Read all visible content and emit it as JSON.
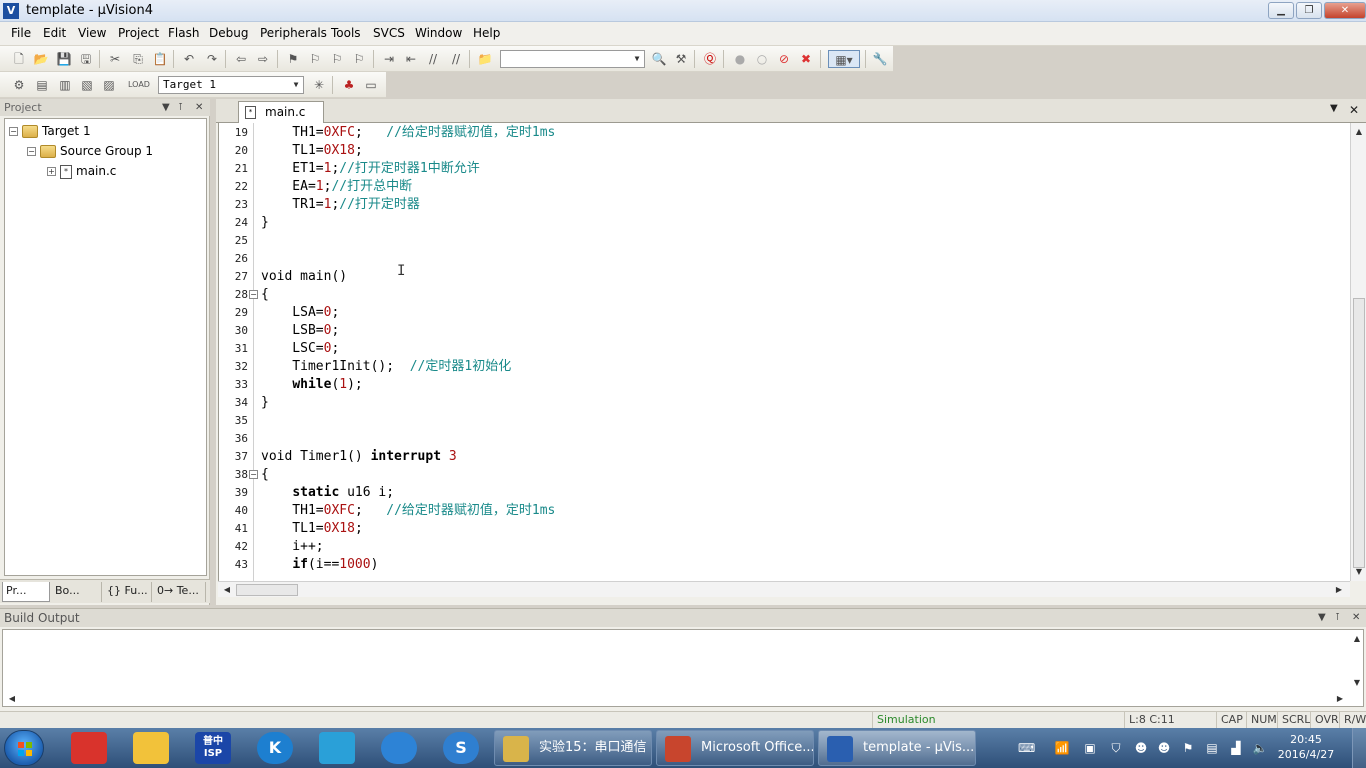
{
  "window": {
    "title": "template  - µVision4",
    "app_icon": "V"
  },
  "menu": [
    "File",
    "Edit",
    "View",
    "Project",
    "Flash",
    "Debug",
    "Peripherals",
    "Tools",
    "SVCS",
    "Window",
    "Help"
  ],
  "toolbar": {
    "target_combo": "Target 1"
  },
  "project_panel": {
    "title": "Project",
    "tree": {
      "target": "Target 1",
      "group": "Source Group 1",
      "file": "main.c"
    },
    "tabs": [
      "Pr...",
      "Bo...",
      "{} Fu...",
      "0→ Te..."
    ]
  },
  "editor": {
    "tab": "main.c",
    "lines": [
      {
        "n": "19",
        "segs": [
          [
            "    TH1=",
            ""
          ],
          [
            "0XFC",
            "num"
          ],
          [
            ";   ",
            ""
          ],
          [
            "//给定时器赋初值，定时1ms",
            "cm"
          ]
        ]
      },
      {
        "n": "20",
        "segs": [
          [
            "    TL1=",
            ""
          ],
          [
            "0X18",
            "num"
          ],
          [
            ";",
            ""
          ]
        ]
      },
      {
        "n": "21",
        "segs": [
          [
            "    ET1=",
            ""
          ],
          [
            "1",
            "num"
          ],
          [
            ";",
            ""
          ],
          [
            "//打开定时器1中断允许",
            "cm"
          ]
        ]
      },
      {
        "n": "22",
        "segs": [
          [
            "    EA=",
            ""
          ],
          [
            "1",
            "num"
          ],
          [
            ";",
            ""
          ],
          [
            "//打开总中断",
            "cm"
          ]
        ]
      },
      {
        "n": "23",
        "segs": [
          [
            "    TR1=",
            ""
          ],
          [
            "1",
            "num"
          ],
          [
            ";",
            ""
          ],
          [
            "//打开定时器",
            "cm"
          ]
        ]
      },
      {
        "n": "24",
        "segs": [
          [
            "}",
            ""
          ]
        ]
      },
      {
        "n": "25",
        "segs": []
      },
      {
        "n": "26",
        "segs": []
      },
      {
        "n": "27",
        "segs": [
          [
            "void main()",
            ""
          ]
        ]
      },
      {
        "n": "28",
        "segs": [
          [
            "{",
            ""
          ]
        ]
      },
      {
        "n": "29",
        "segs": [
          [
            "    LSA=",
            ""
          ],
          [
            "0",
            "num"
          ],
          [
            ";",
            ""
          ]
        ]
      },
      {
        "n": "30",
        "segs": [
          [
            "    LSB=",
            ""
          ],
          [
            "0",
            "num"
          ],
          [
            ";",
            ""
          ]
        ]
      },
      {
        "n": "31",
        "segs": [
          [
            "    LSC=",
            ""
          ],
          [
            "0",
            "num"
          ],
          [
            ";",
            ""
          ]
        ]
      },
      {
        "n": "32",
        "segs": [
          [
            "    Timer1Init();  ",
            ""
          ],
          [
            "//定时器1初始化",
            "cm"
          ]
        ]
      },
      {
        "n": "33",
        "segs": [
          [
            "    ",
            ""
          ],
          [
            "while",
            "kw"
          ],
          [
            "(",
            ""
          ],
          [
            "1",
            "num"
          ],
          [
            ");",
            ""
          ]
        ]
      },
      {
        "n": "34",
        "segs": [
          [
            "}",
            ""
          ]
        ]
      },
      {
        "n": "35",
        "segs": []
      },
      {
        "n": "36",
        "segs": []
      },
      {
        "n": "37",
        "segs": [
          [
            "void Timer1() ",
            ""
          ],
          [
            "interrupt",
            "kw"
          ],
          [
            " ",
            ""
          ],
          [
            "3",
            "num"
          ]
        ]
      },
      {
        "n": "38",
        "segs": [
          [
            "{",
            ""
          ]
        ]
      },
      {
        "n": "39",
        "segs": [
          [
            "    ",
            ""
          ],
          [
            "static",
            "kw"
          ],
          [
            " u16 i;",
            ""
          ]
        ]
      },
      {
        "n": "40",
        "segs": [
          [
            "    TH1=",
            ""
          ],
          [
            "0XFC",
            "num"
          ],
          [
            ";   ",
            ""
          ],
          [
            "//给定时器赋初值，定时1ms",
            "cm"
          ]
        ]
      },
      {
        "n": "41",
        "segs": [
          [
            "    TL1=",
            ""
          ],
          [
            "0X18",
            "num"
          ],
          [
            ";",
            ""
          ]
        ]
      },
      {
        "n": "42",
        "segs": [
          [
            "    i++;",
            ""
          ]
        ]
      },
      {
        "n": "43",
        "segs": [
          [
            "    ",
            ""
          ],
          [
            "if",
            "kw"
          ],
          [
            "(i==",
            ""
          ],
          [
            "1000",
            "num"
          ],
          [
            ")",
            ""
          ]
        ]
      }
    ]
  },
  "build_output": {
    "title": "Build Output"
  },
  "status": {
    "mode": "Simulation",
    "position": "L:8 C:11",
    "caps": "CAP",
    "num": "NUM",
    "scrl": "SCRL",
    "ovr": "OVR",
    "rw": "R/W"
  },
  "taskbar": {
    "tasks": [
      {
        "label": "实验15：串口通信",
        "color": "#d9b44a"
      },
      {
        "label": "Microsoft Office...",
        "color": "#c8452d"
      },
      {
        "label": "template  - µVis...",
        "color": "#2a5fb0"
      }
    ],
    "apps": [
      {
        "label": "",
        "color": "#d9332c"
      },
      {
        "label": "",
        "color": "#f2c23a"
      },
      {
        "label": "普中\nISP",
        "color": "#1b46a8"
      },
      {
        "label": "K",
        "color": "#1d7fd0"
      },
      {
        "label": "",
        "color": "#2aa0d8"
      },
      {
        "label": "",
        "color": "#2d83d6"
      },
      {
        "label": "S",
        "color": "#2f7fd0"
      }
    ],
    "clock_time": "20:45",
    "clock_date": "2016/4/27"
  },
  "colors": {
    "comment": "#1a8a8a",
    "number": "#a11111",
    "accent": "#1c4fa0"
  }
}
